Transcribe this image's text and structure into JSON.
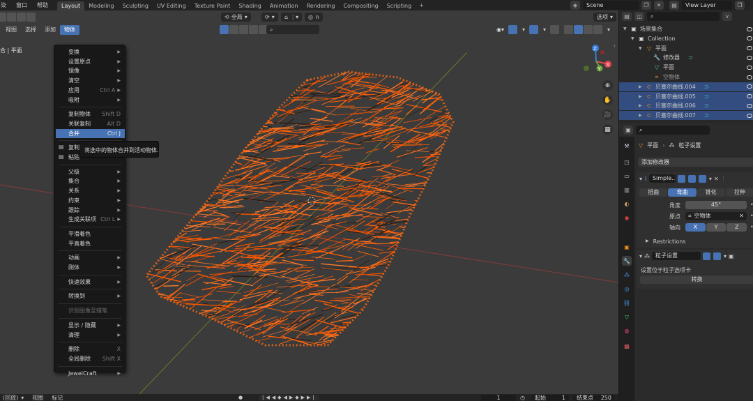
{
  "topbar": {
    "menus": [
      "染",
      "窗口",
      "帮助"
    ],
    "tabs": [
      {
        "label": "Layout",
        "active": true
      },
      {
        "label": "Modeling"
      },
      {
        "label": "Sculpting"
      },
      {
        "label": "UV Editing"
      },
      {
        "label": "Texture Paint"
      },
      {
        "label": "Shading"
      },
      {
        "label": "Animation"
      },
      {
        "label": "Rendering"
      },
      {
        "label": "Compositing"
      },
      {
        "label": "Scripting"
      }
    ],
    "add_tab": "+",
    "scene": "Scene",
    "view_layer": "View Layer"
  },
  "viewport": {
    "menus": [
      "视图",
      "选择",
      "添加",
      "物体"
    ],
    "active_menu": "物体",
    "orientation": "全局",
    "options": "选项",
    "title": "合 | 平面",
    "gizmo": {
      "x": "X",
      "y": "Y",
      "z": "Z"
    }
  },
  "object_menu": {
    "items": [
      {
        "label": "变换",
        "shortcut": "",
        "submenu": true
      },
      {
        "label": "设置原点",
        "shortcut": "",
        "submenu": true
      },
      {
        "label": "镜像",
        "shortcut": "",
        "submenu": true
      },
      {
        "label": "清空",
        "shortcut": "",
        "submenu": true
      },
      {
        "label": "应用",
        "shortcut": "Ctrl A",
        "submenu": true
      },
      {
        "label": "吸附",
        "shortcut": "",
        "submenu": true
      },
      {
        "sep": true
      },
      {
        "label": "复制物体",
        "shortcut": "Shift D"
      },
      {
        "label": "关联复制",
        "shortcut": "Alt D"
      },
      {
        "label": "合并",
        "shortcut": "Ctrl J",
        "highlight": true
      },
      {
        "sep": true
      },
      {
        "label": "复制",
        "shortcut": "",
        "icon": true
      },
      {
        "label": "粘贴",
        "shortcut": "",
        "icon": true
      },
      {
        "sep": true
      },
      {
        "label": "父级",
        "shortcut": "",
        "submenu": true
      },
      {
        "label": "集合",
        "shortcut": "",
        "submenu": true
      },
      {
        "label": "关系",
        "shortcut": "",
        "submenu": true
      },
      {
        "label": "约束",
        "shortcut": "",
        "submenu": true
      },
      {
        "label": "跟踪",
        "shortcut": "",
        "submenu": true
      },
      {
        "label": "生成关联项",
        "shortcut": "Ctrl L",
        "submenu": true
      },
      {
        "sep": true
      },
      {
        "label": "平滑着色",
        "shortcut": ""
      },
      {
        "label": "平直着色",
        "shortcut": ""
      },
      {
        "sep": true
      },
      {
        "label": "动画",
        "shortcut": "",
        "submenu": true
      },
      {
        "label": "刚体",
        "shortcut": "",
        "submenu": true
      },
      {
        "sep": true
      },
      {
        "label": "快速效果",
        "shortcut": "",
        "submenu": true
      },
      {
        "sep": true
      },
      {
        "label": "转换到",
        "shortcut": "",
        "submenu": true
      },
      {
        "sep": true
      },
      {
        "label": "识别图像至蜡笔",
        "shortcut": "",
        "disabled": true
      },
      {
        "sep": true
      },
      {
        "label": "显示 / 隐藏",
        "shortcut": "",
        "submenu": true
      },
      {
        "label": "清理",
        "shortcut": "",
        "submenu": true
      },
      {
        "sep": true
      },
      {
        "label": "删除",
        "shortcut": "X"
      },
      {
        "label": "全局删除",
        "shortcut": "Shift X"
      },
      {
        "sep": true
      },
      {
        "label": "JewelCraft",
        "shortcut": "",
        "submenu": true
      }
    ],
    "tooltip": "将选中的物体合并到活动物体."
  },
  "outliner": {
    "search_placeholder": "",
    "rows": [
      {
        "label": "场景集合",
        "indent": 0,
        "icon": "collection"
      },
      {
        "label": "Collection",
        "indent": 1,
        "icon": "collection"
      },
      {
        "label": "平面",
        "indent": 2,
        "icon": "mesh"
      },
      {
        "label": "修改器",
        "indent": 3,
        "icon": "wrench"
      },
      {
        "label": "平面",
        "indent": 3,
        "icon": "mesh-data"
      },
      {
        "label": "空物体",
        "indent": 3,
        "icon": "empty"
      },
      {
        "label": "贝塞尔曲线.004",
        "indent": 2,
        "icon": "curve",
        "selected": true
      },
      {
        "label": "贝塞尔曲线.005",
        "indent": 2,
        "icon": "curve",
        "selected": true
      },
      {
        "label": "贝塞尔曲线.006",
        "indent": 2,
        "icon": "curve",
        "selected": true
      },
      {
        "label": "贝塞尔曲线.007",
        "indent": 2,
        "icon": "curve",
        "selected": true
      }
    ]
  },
  "properties": {
    "breadcrumb_object": "平面",
    "breadcrumb_item": "粒子设置",
    "add_modifier": "添加修改器",
    "modifier1": {
      "name": "Simple...",
      "modes": [
        "扭曲",
        "弯曲",
        "锥化",
        "拉伸"
      ],
      "active_mode": "弯曲",
      "angle_label": "角度",
      "angle_value": "45°",
      "origin_label": "原点",
      "origin_value": "空物体",
      "axis_label": "轴向",
      "axes": [
        "X",
        "Y",
        "Z"
      ],
      "active_axis": "X",
      "restrictions": "Restrictions"
    },
    "modifier2": {
      "name": "粒子设置",
      "info": "设置位于粒子选项卡",
      "convert": "转换"
    }
  },
  "timeline": {
    "menus": [
      "(回放)",
      "视图",
      "标记"
    ],
    "current_frame": "1",
    "start_label": "起始",
    "start": "1",
    "end_label": "结束点",
    "end": "250"
  },
  "colors": {
    "accent": "#4772b3",
    "mesh": "#ff5a00",
    "viewport_bg": "#3b3b3b"
  }
}
